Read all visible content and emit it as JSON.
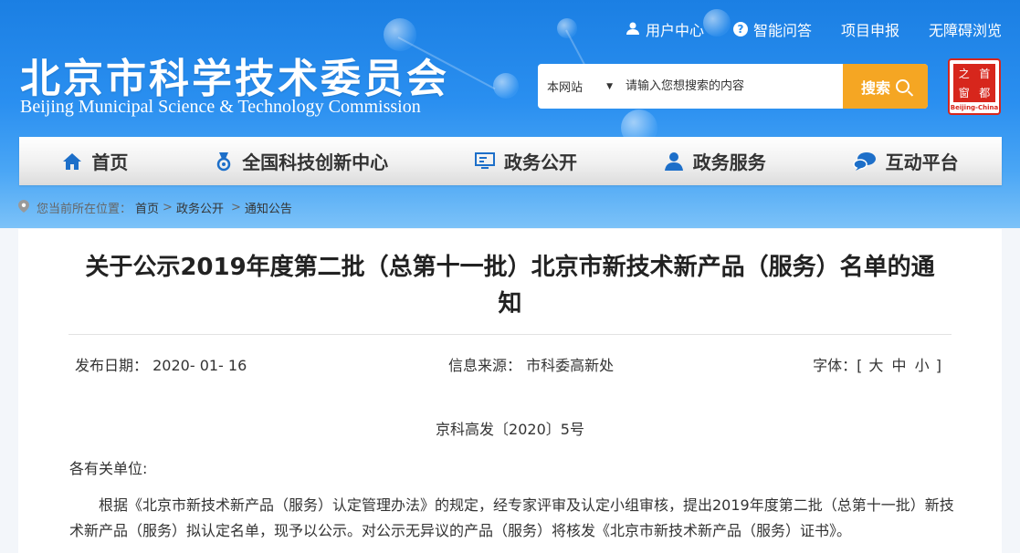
{
  "header": {
    "logo_cn": "北京市科学技术委员会",
    "logo_en": "Beijing Municipal Science & Technology Commission",
    "top_links": [
      "用户中心",
      "智能问答",
      "项目申报",
      "无障碍浏览"
    ],
    "search": {
      "scope": "本网站",
      "placeholder": "请输入您想搜索的内容",
      "button": "搜索"
    },
    "capital_logo": {
      "chars": [
        "之",
        "首",
        "窗",
        "都"
      ],
      "caption": "Beijing-China"
    }
  },
  "nav": [
    "首页",
    "全国科技创新中心",
    "政务公开",
    "政务服务",
    "互动平台"
  ],
  "breadcrumb": {
    "prefix": "您当前所在位置：",
    "items": [
      "首页",
      "政务公开",
      "通知公告"
    ],
    "separator": ">"
  },
  "article": {
    "title": "关于公示2019年度第二批（总第十一批）北京市新技术新产品（服务）名单的通知",
    "date_label": "发布日期：",
    "date": "2020- 01- 16",
    "source_label": "信息来源：",
    "source": "市科委高新处",
    "font_label": "字体：[",
    "font_sizes": [
      "大",
      "中",
      "小"
    ],
    "font_close": "]",
    "doc_no": "京科高发〔2020〕5号",
    "salutation": "各有关单位:",
    "body": "根据《北京市新技术新产品（服务）认定管理办法》的规定，经专家评审及认定小组审核，提出2019年度第二批（总第十一批）新技术新产品（服务）拟认定名单，现予以公示。对公示无异议的产品（服务）将核发《北京市新技术新产品（服务）证书》。"
  },
  "colors": {
    "header_blue": "#1b7fe3",
    "search_orange": "#f5a623",
    "nav_icon": "#1d6fc9",
    "capital_red": "#d7261c"
  }
}
